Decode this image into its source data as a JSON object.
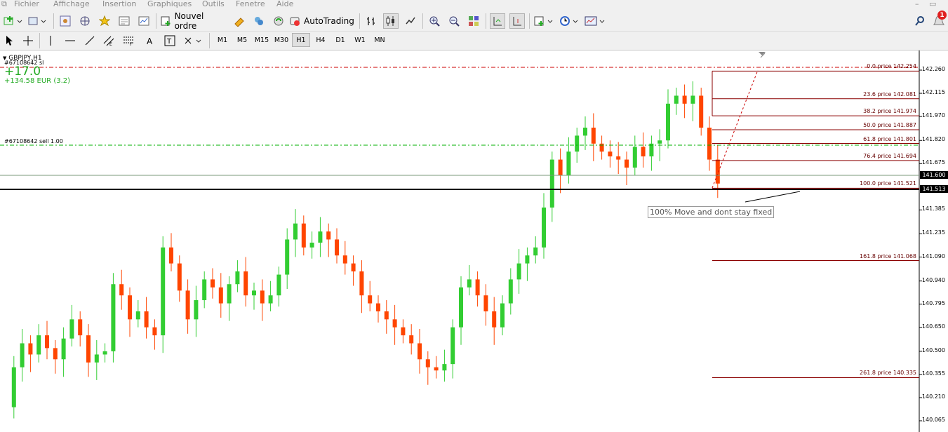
{
  "menu": [
    "Fichier",
    "Affichage",
    "Insertion",
    "Graphiques",
    "Outils",
    "Fenetre",
    "Aide"
  ],
  "toolbar": {
    "new_order_label": "Nouvel ordre",
    "autotrading_label": "AutoTrading",
    "notification_count": "1"
  },
  "timeframes": [
    "M1",
    "M5",
    "M15",
    "M30",
    "H1",
    "H4",
    "D1",
    "W1",
    "MN"
  ],
  "active_timeframe": "H1",
  "chart": {
    "symbol": "GBPJPY,H1",
    "order_sl_label": "#67108642 sl",
    "profit_points": "+17.0",
    "profit_money": "+134.58 EUR (3.2)",
    "order_label": "#67108642 sell 1.00",
    "annotation": "100% Move and dont stay fixed",
    "fib_levels": [
      {
        "label": "0.0 price 142.254",
        "price": 142.254
      },
      {
        "label": "23.6 price 142.081",
        "price": 142.081
      },
      {
        "label": "38.2 price 141.974",
        "price": 141.974
      },
      {
        "label": "50.0 price 141.887",
        "price": 141.887
      },
      {
        "label": "61.8 price 141.801",
        "price": 141.801
      },
      {
        "label": "76.4 price 141.694",
        "price": 141.694
      },
      {
        "label": "100.0 price 141.521",
        "price": 141.521
      },
      {
        "label": "161.8 price 141.068",
        "price": 141.068
      },
      {
        "label": "261.8 price 140.335",
        "price": 140.335
      }
    ],
    "price_ticks": [
      "142.260",
      "142.115",
      "141.970",
      "141.820",
      "141.675",
      "141.385",
      "141.235",
      "141.090",
      "140.940",
      "140.795",
      "140.650",
      "140.500",
      "140.355",
      "140.210",
      "140.065"
    ],
    "bid_label": "141.600",
    "current_label": "141.513"
  },
  "chart_data": {
    "type": "candlestick",
    "ylim": [
      140.05,
      142.32
    ],
    "colors": {
      "bull": "#32cd32",
      "bear": "#ff4500",
      "fib": "#8b0000",
      "sl": "#cc0000",
      "order": "#00b000"
    }
  }
}
